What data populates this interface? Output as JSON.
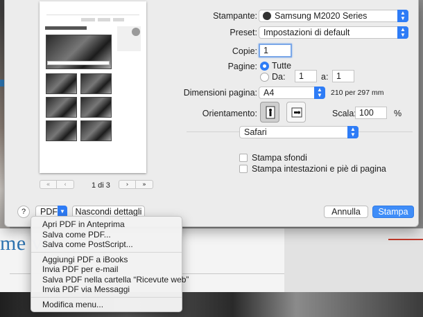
{
  "background": {
    "headline": "me vo"
  },
  "printer": {
    "label": "Stampante:",
    "value": "Samsung M2020 Series"
  },
  "preset": {
    "label": "Preset:",
    "value": "Impostazioni di default"
  },
  "copies": {
    "label": "Copie:",
    "value": "1"
  },
  "pages": {
    "label": "Pagine:",
    "all": "Tutte",
    "from_label": "Da:",
    "from": "1",
    "to_label": "a:",
    "to": "1"
  },
  "paper_size": {
    "label": "Dimensioni pagina:",
    "value": "A4",
    "dims": "210 per 297 mm"
  },
  "orientation": {
    "label": "Orientamento:"
  },
  "scale": {
    "label": "Scala:",
    "value": "100",
    "unit": "%"
  },
  "section": {
    "value": "Safari"
  },
  "options": {
    "backgrounds": "Stampa sfondi",
    "headers": "Stampa intestazioni e piè di pagina"
  },
  "preview": {
    "page_indicator": "1 di 3",
    "first": "«",
    "prev": "‹",
    "next": "›",
    "last": "»"
  },
  "footer": {
    "help": "?",
    "pdf": "PDF",
    "hide_details": "Nascondi dettagli",
    "cancel": "Annulla",
    "print": "Stampa"
  },
  "pdf_menu": {
    "group1": [
      "Apri PDF in Anteprima",
      "Salva come PDF...",
      "Salva come PostScript..."
    ],
    "group2": [
      "Aggiungi PDF a iBooks",
      "Invia PDF per e-mail",
      "Salva PDF nella cartella “Ricevute web”",
      "Invia PDF via Messaggi"
    ],
    "group3": [
      "Modifica menu..."
    ]
  },
  "colors": {
    "accent": "#2e7cf6",
    "link": "#2e73b0"
  }
}
